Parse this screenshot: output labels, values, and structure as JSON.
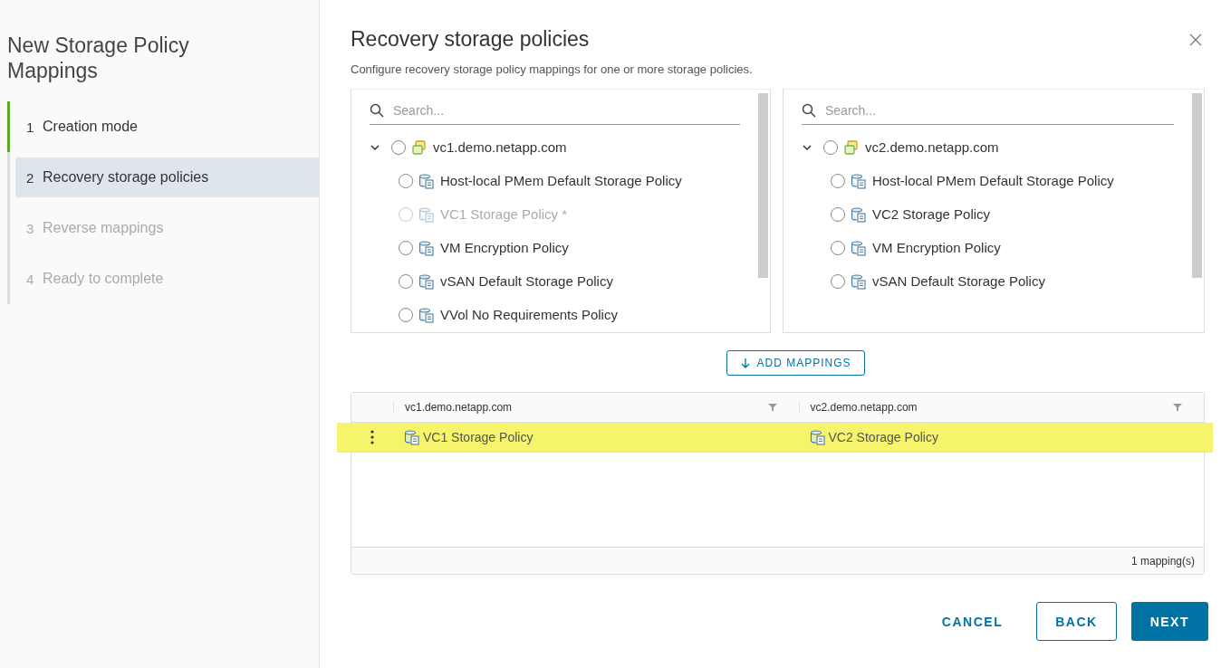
{
  "sidebar": {
    "title": "New Storage Policy Mappings",
    "steps": [
      {
        "number": "1",
        "label": "Creation mode",
        "completed": true,
        "selected": false,
        "disabled": false
      },
      {
        "number": "2",
        "label": "Recovery storage policies",
        "completed": false,
        "selected": true,
        "disabled": false
      },
      {
        "number": "3",
        "label": "Reverse mappings",
        "completed": false,
        "selected": false,
        "disabled": true
      },
      {
        "number": "4",
        "label": "Ready to complete",
        "completed": false,
        "selected": false,
        "disabled": true
      }
    ]
  },
  "dialog": {
    "title": "Recovery storage policies",
    "subtitle": "Configure recovery storage policy mappings for one or more storage policies."
  },
  "trees": [
    {
      "search": {
        "placeholder": "Search..."
      },
      "root": {
        "label": "vc1.demo.netapp.com",
        "expanded": true,
        "selected": false,
        "children": [
          {
            "label": "Host-local PMem Default Storage Policy",
            "selected": false,
            "disabled": false
          },
          {
            "label": "VC1 Storage Policy *",
            "selected": false,
            "disabled": true
          },
          {
            "label": "VM Encryption Policy",
            "selected": false,
            "disabled": false
          },
          {
            "label": "vSAN Default Storage Policy",
            "selected": false,
            "disabled": false
          },
          {
            "label": "VVol No Requirements Policy",
            "selected": false,
            "disabled": false
          }
        ]
      }
    },
    {
      "search": {
        "placeholder": "Search..."
      },
      "root": {
        "label": "vc2.demo.netapp.com",
        "expanded": true,
        "selected": false,
        "children": [
          {
            "label": "Host-local PMem Default Storage Policy",
            "selected": false,
            "disabled": false
          },
          {
            "label": "VC2 Storage Policy",
            "selected": false,
            "disabled": false
          },
          {
            "label": "VM Encryption Policy",
            "selected": false,
            "disabled": false
          },
          {
            "label": "vSAN Default Storage Policy",
            "selected": false,
            "disabled": false
          }
        ]
      }
    }
  ],
  "add_button": "ADD MAPPINGS",
  "table": {
    "columns": [
      "vc1.demo.netapp.com",
      "vc2.demo.netapp.com"
    ],
    "rows": [
      {
        "cells": [
          "VC1 Storage Policy",
          "VC2 Storage Policy"
        ],
        "highlighted": true
      }
    ],
    "footer": "1 mapping(s)"
  },
  "buttons": [
    {
      "label": "CANCEL",
      "kind": "link"
    },
    {
      "label": "BACK",
      "kind": "outline"
    },
    {
      "label": "NEXT",
      "kind": "primary"
    }
  ]
}
